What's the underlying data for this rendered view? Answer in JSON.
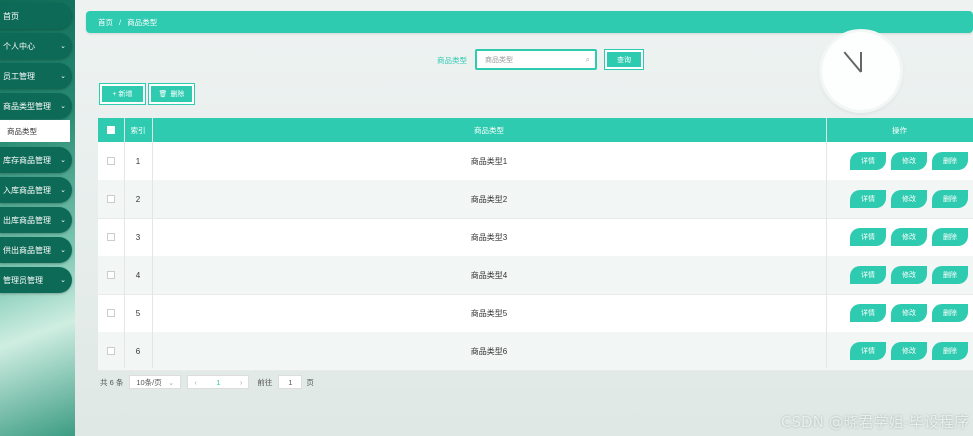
{
  "sidebar": {
    "items": [
      {
        "label": "首页",
        "expandable": false
      },
      {
        "label": "个人中心",
        "expandable": true
      },
      {
        "label": "员工管理",
        "expandable": true
      },
      {
        "label": "商品类型管理",
        "expandable": true
      },
      {
        "label": "库存商品管理",
        "expandable": true
      },
      {
        "label": "入库商品管理",
        "expandable": true
      },
      {
        "label": "出库商品管理",
        "expandable": true
      },
      {
        "label": "供出商品管理",
        "expandable": true
      },
      {
        "label": "管理员管理",
        "expandable": true
      }
    ],
    "active_sub": "商品类型",
    "chevron": "chevron-down-icon"
  },
  "breadcrumb": {
    "home": "首页",
    "sep": "/",
    "current": "商品类型"
  },
  "search": {
    "label": "商品类型",
    "placeholder": "商品类型",
    "button": "查询"
  },
  "toolbar": {
    "add": "+ 新增",
    "delete": "删除"
  },
  "table": {
    "headers": {
      "index": "索引",
      "name": "商品类型",
      "ops": "操作"
    },
    "rows": [
      {
        "index": "1",
        "name": "商品类型1"
      },
      {
        "index": "2",
        "name": "商品类型2"
      },
      {
        "index": "3",
        "name": "商品类型3"
      },
      {
        "index": "4",
        "name": "商品类型4"
      },
      {
        "index": "5",
        "name": "商品类型5"
      },
      {
        "index": "6",
        "name": "商品类型6"
      }
    ],
    "actions": {
      "detail": "详情",
      "edit": "修改",
      "delete": "删除"
    }
  },
  "pager": {
    "total": "共 6 条",
    "page_size": "10条/页",
    "current_page": "1",
    "goto_label": "前往",
    "goto_value": "1",
    "goto_suffix": "页"
  },
  "watermark": "CSDN @晓君学姐-毕设程序",
  "colors": {
    "accent": "#2ecbb0",
    "sidebar": "#0c6a57"
  }
}
